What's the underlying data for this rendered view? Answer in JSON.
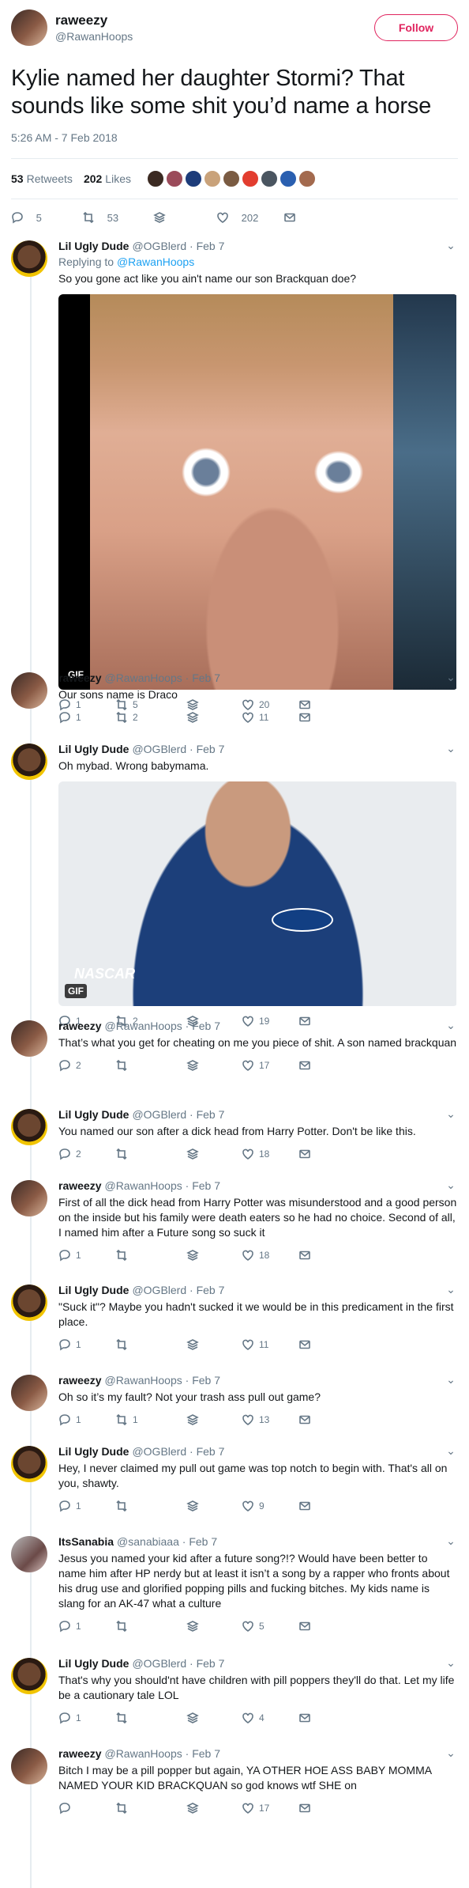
{
  "main": {
    "name": "raweezy",
    "handle": "@RawanHoops",
    "follow_label": "Follow",
    "text": "Kylie named her daughter Stormi? That sounds like some shit you’d name a horse",
    "timestamp": "5:26 AM - 7 Feb 2018",
    "retweets_count": "53",
    "retweets_label": "Retweets",
    "likes_count": "202",
    "likes_label": "Likes",
    "replies": "5",
    "retweets": "53",
    "likes": "202"
  },
  "replies": [
    {
      "name": "Lil Ugly Dude",
      "handle": "@OGBlerd",
      "date": "Feb 7",
      "replying_prefix": "Replying to",
      "replying_to": "@RawanHoops",
      "text": "So you gone act like you ain't name our son Brackquan doe?",
      "gif": "GIF",
      "replies": "1",
      "retweets": "5",
      "likes": "20"
    },
    {
      "name": "raweezy",
      "handle": "@RawanHoops",
      "date": "Feb 7",
      "text": "Our sons name is Draco",
      "replies": "1",
      "retweets": "2",
      "likes": "11"
    },
    {
      "name": "Lil Ugly Dude",
      "handle": "@OGBlerd",
      "date": "Feb 7",
      "text": "Oh mybad. Wrong babymama.",
      "gif": "GIF",
      "brand": "NASCAR",
      "replies": "1",
      "retweets": "2",
      "likes": "19"
    },
    {
      "name": "raweezy",
      "handle": "@RawanHoops",
      "date": "Feb 7",
      "text": "That’s what you get for cheating on me you piece of shit. A son named brackquan",
      "replies": "2",
      "retweets": "",
      "likes": "17"
    },
    {
      "name": "Lil Ugly Dude",
      "handle": "@OGBlerd",
      "date": "Feb 7",
      "text": "You named our son after a dick head from Harry Potter. Don't be like this.",
      "replies": "2",
      "retweets": "",
      "likes": "18"
    },
    {
      "name": "raweezy",
      "handle": "@RawanHoops",
      "date": "Feb 7",
      "text": "First of all the dick head from Harry Potter was misunderstood and a good person on the inside but his family were death eaters so he had no choice. Second of all, I named him after a Future song so suck it",
      "replies": "1",
      "retweets": "",
      "likes": "18"
    },
    {
      "name": "Lil Ugly Dude",
      "handle": "@OGBlerd",
      "date": "Feb 7",
      "text": "\"Suck it\"? Maybe you hadn't sucked it we would be in this predicament in the first place.",
      "replies": "1",
      "retweets": "",
      "likes": "11"
    },
    {
      "name": "raweezy",
      "handle": "@RawanHoops",
      "date": "Feb 7",
      "text": "Oh so it’s my fault? Not your trash ass pull out game?",
      "replies": "1",
      "retweets": "1",
      "likes": "13"
    },
    {
      "name": "Lil Ugly Dude",
      "handle": "@OGBlerd",
      "date": "Feb 7",
      "text": "Hey, I never claimed my pull out game was top notch to begin with. That's all on you, shawty.",
      "replies": "1",
      "retweets": "",
      "likes": "9"
    },
    {
      "name": "ItsSanabia",
      "handle": "@sanabiaaa",
      "date": "Feb 7",
      "text": "Jesus you named your kid after a future song?!? Would have been better to name him after HP nerdy but at least it isn’t a song by a rapper who fronts about his drug use and glorified popping pills and fucking bitches. My kids name is slang for an AK-47 what a culture",
      "replies": "1",
      "retweets": "",
      "likes": "5"
    },
    {
      "name": "Lil Ugly Dude",
      "handle": "@OGBlerd",
      "date": "Feb 7",
      "text": "That's why you should'nt have children with pill poppers they'll do that. Let my life be a cautionary tale LOL",
      "replies": "1",
      "retweets": "",
      "likes": "4"
    },
    {
      "name": "raweezy",
      "handle": "@RawanHoops",
      "date": "Feb 7",
      "text": "Bitch I may be a pill popper but again, YA OTHER HOE ASS BABY MOMMA NAMED YOUR KID BRACKQUAN so god knows wtf SHE on",
      "replies": "",
      "retweets": "",
      "likes": "17"
    }
  ],
  "colors": {
    "link": "#1da1f2",
    "follow": "#e0245e",
    "muted": "#657786"
  }
}
